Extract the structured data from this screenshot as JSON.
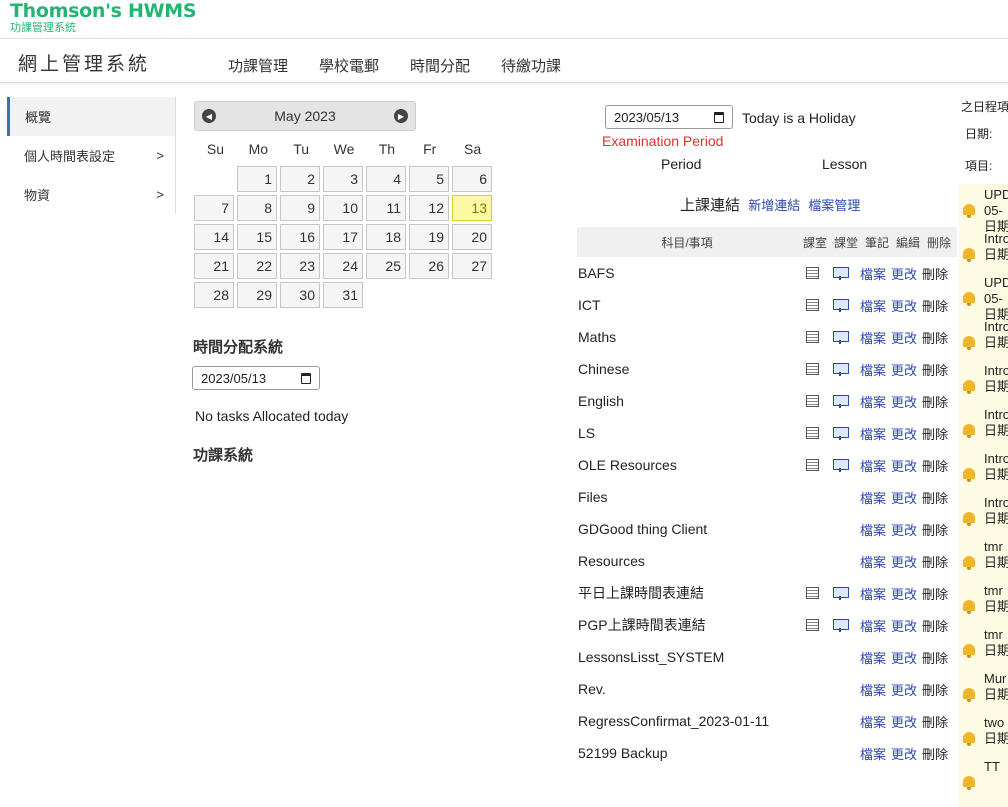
{
  "brand": {
    "title": "Thomson's HWMS",
    "subtitle": "功課管理系統"
  },
  "header": {
    "site_title": "網上管理系統",
    "menu": [
      "功課管理",
      "學校電郵",
      "時間分配",
      "待繳功課"
    ]
  },
  "sidebar": {
    "items": [
      {
        "label": "概覽",
        "arrow": ""
      },
      {
        "label": "個人時間表設定",
        "arrow": ">"
      },
      {
        "label": "物資",
        "arrow": ">"
      }
    ]
  },
  "calendar": {
    "month_label": "May 2023",
    "dows": [
      "Su",
      "Mo",
      "Tu",
      "We",
      "Th",
      "Fr",
      "Sa"
    ],
    "days": [
      "",
      "1",
      "2",
      "3",
      "4",
      "5",
      "6",
      "7",
      "8",
      "9",
      "10",
      "11",
      "12",
      "13",
      "14",
      "15",
      "16",
      "17",
      "18",
      "19",
      "20",
      "21",
      "22",
      "23",
      "24",
      "25",
      "26",
      "27",
      "28",
      "29",
      "30",
      "31"
    ],
    "today": "13"
  },
  "timeslot": {
    "title": "時間分配系統",
    "date_value": "2023/05/13",
    "message": "No tasks Allocated today"
  },
  "homework": {
    "title": "功課系統"
  },
  "day_info": {
    "date_value": "2023/05/13",
    "holiday_text": "Today is a Holiday",
    "period_note": "Examination Period",
    "period_header": "Period",
    "lesson_header": "Lesson"
  },
  "links": {
    "title": "上課連結",
    "new_link": "新增連結",
    "file_manage": "檔案管理",
    "headers": {
      "subject": "科目/事項",
      "classroom": "課室",
      "lesson": "課堂",
      "notes": "筆記",
      "edit": "編緝",
      "delete": "刪除"
    },
    "action_labels": {
      "file": "檔案",
      "edit": "更改",
      "delete": "刪除"
    },
    "rows": [
      {
        "subject": "BAFS",
        "icons": true
      },
      {
        "subject": "ICT",
        "icons": true
      },
      {
        "subject": "Maths",
        "icons": true
      },
      {
        "subject": "Chinese",
        "icons": true
      },
      {
        "subject": "English",
        "icons": true
      },
      {
        "subject": "LS",
        "icons": true
      },
      {
        "subject": "OLE Resources",
        "icons": true
      },
      {
        "subject": "Files",
        "icons": false
      },
      {
        "subject": "GDGood thing Client",
        "icons": false
      },
      {
        "subject": "Resources",
        "icons": false
      },
      {
        "subject": "平日上課時間表連結",
        "icons": true
      },
      {
        "subject": "PGP上課時間表連結",
        "icons": true
      },
      {
        "subject": "LessonsLisst_SYSTEM",
        "icons": false
      },
      {
        "subject": "Rev.",
        "icons": false
      },
      {
        "subject": "RegressConfirmat_2023-01-11",
        "icons": false
      },
      {
        "subject": "52199 Backup",
        "icons": false
      }
    ]
  },
  "schedule": {
    "title": "之日程項",
    "date_label": "日期:",
    "item_label": "項目:",
    "items": [
      {
        "line1": "UPD",
        "line2": "05-",
        "line3": "日期"
      },
      {
        "line1": "Intro",
        "line2": "日期",
        "line3": ""
      },
      {
        "line1": "UPD",
        "line2": "05-",
        "line3": "日期"
      },
      {
        "line1": "Intro",
        "line2": "日期",
        "line3": ""
      },
      {
        "line1": "Intro",
        "line2": "日期",
        "line3": ""
      },
      {
        "line1": "Intro",
        "line2": "日期",
        "line3": ""
      },
      {
        "line1": "Intro",
        "line2": "日期",
        "line3": ""
      },
      {
        "line1": "Intro",
        "line2": "日期",
        "line3": ""
      },
      {
        "line1": "tmr",
        "line2": "日期",
        "line3": ""
      },
      {
        "line1": "tmr",
        "line2": "日期",
        "line3": ""
      },
      {
        "line1": "tmr",
        "line2": "日期",
        "line3": ""
      },
      {
        "line1": "Mur",
        "line2": "日期",
        "line3": ""
      },
      {
        "line1": "two",
        "line2": "日期",
        "line3": ""
      },
      {
        "line1": "TT",
        "line2": "",
        "line3": ""
      }
    ]
  }
}
